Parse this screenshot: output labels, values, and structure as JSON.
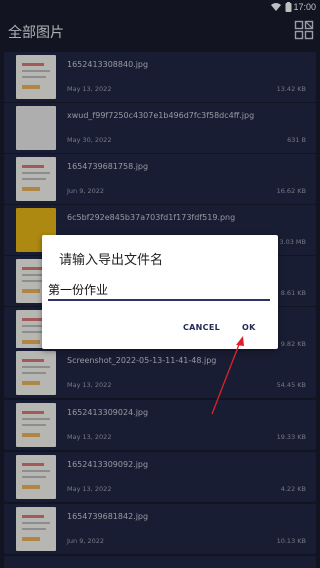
{
  "status": {
    "time": "17:00"
  },
  "appbar": {
    "title": "全部图片"
  },
  "files": [
    {
      "name": "1652413308840.jpg",
      "date": "May 13, 2022",
      "size": "13.42 KB"
    },
    {
      "name": "xwud_f99f7250c4307e1b496d7fc3f58dc4ff.jpg",
      "date": "May 30, 2022",
      "size": "631 B"
    },
    {
      "name": "1654739681758.jpg",
      "date": "Jun 9, 2022",
      "size": "16.62 KB"
    },
    {
      "name": "6c5bf292e845b37a703fd1f173fdf519.png",
      "date": "",
      "size": "3.03 MB"
    },
    {
      "name": "",
      "date": "",
      "size": "8.61 KB"
    },
    {
      "name": "",
      "date": "",
      "size": "9.82 KB"
    },
    {
      "name": "Screenshot_2022-05-13-11-41-48.jpg",
      "date": "May 13, 2022",
      "size": "54.45 KB"
    },
    {
      "name": "1652413309024.jpg",
      "date": "May 13, 2022",
      "size": "19.33 KB"
    },
    {
      "name": "1652413309092.jpg",
      "date": "May 13, 2022",
      "size": "4.22 KB"
    },
    {
      "name": "1654739681842.jpg",
      "date": "Jun 9, 2022",
      "size": "10.13 KB"
    }
  ],
  "dialog": {
    "title": "请输入导出文件名",
    "value": "第一份作业",
    "cancel_label": "CANCEL",
    "ok_label": "OK"
  },
  "colors": {
    "background": "#181b2e",
    "row": "#222744",
    "dialog_button": "#222a55",
    "annotation_arrow": "#e0202a"
  }
}
